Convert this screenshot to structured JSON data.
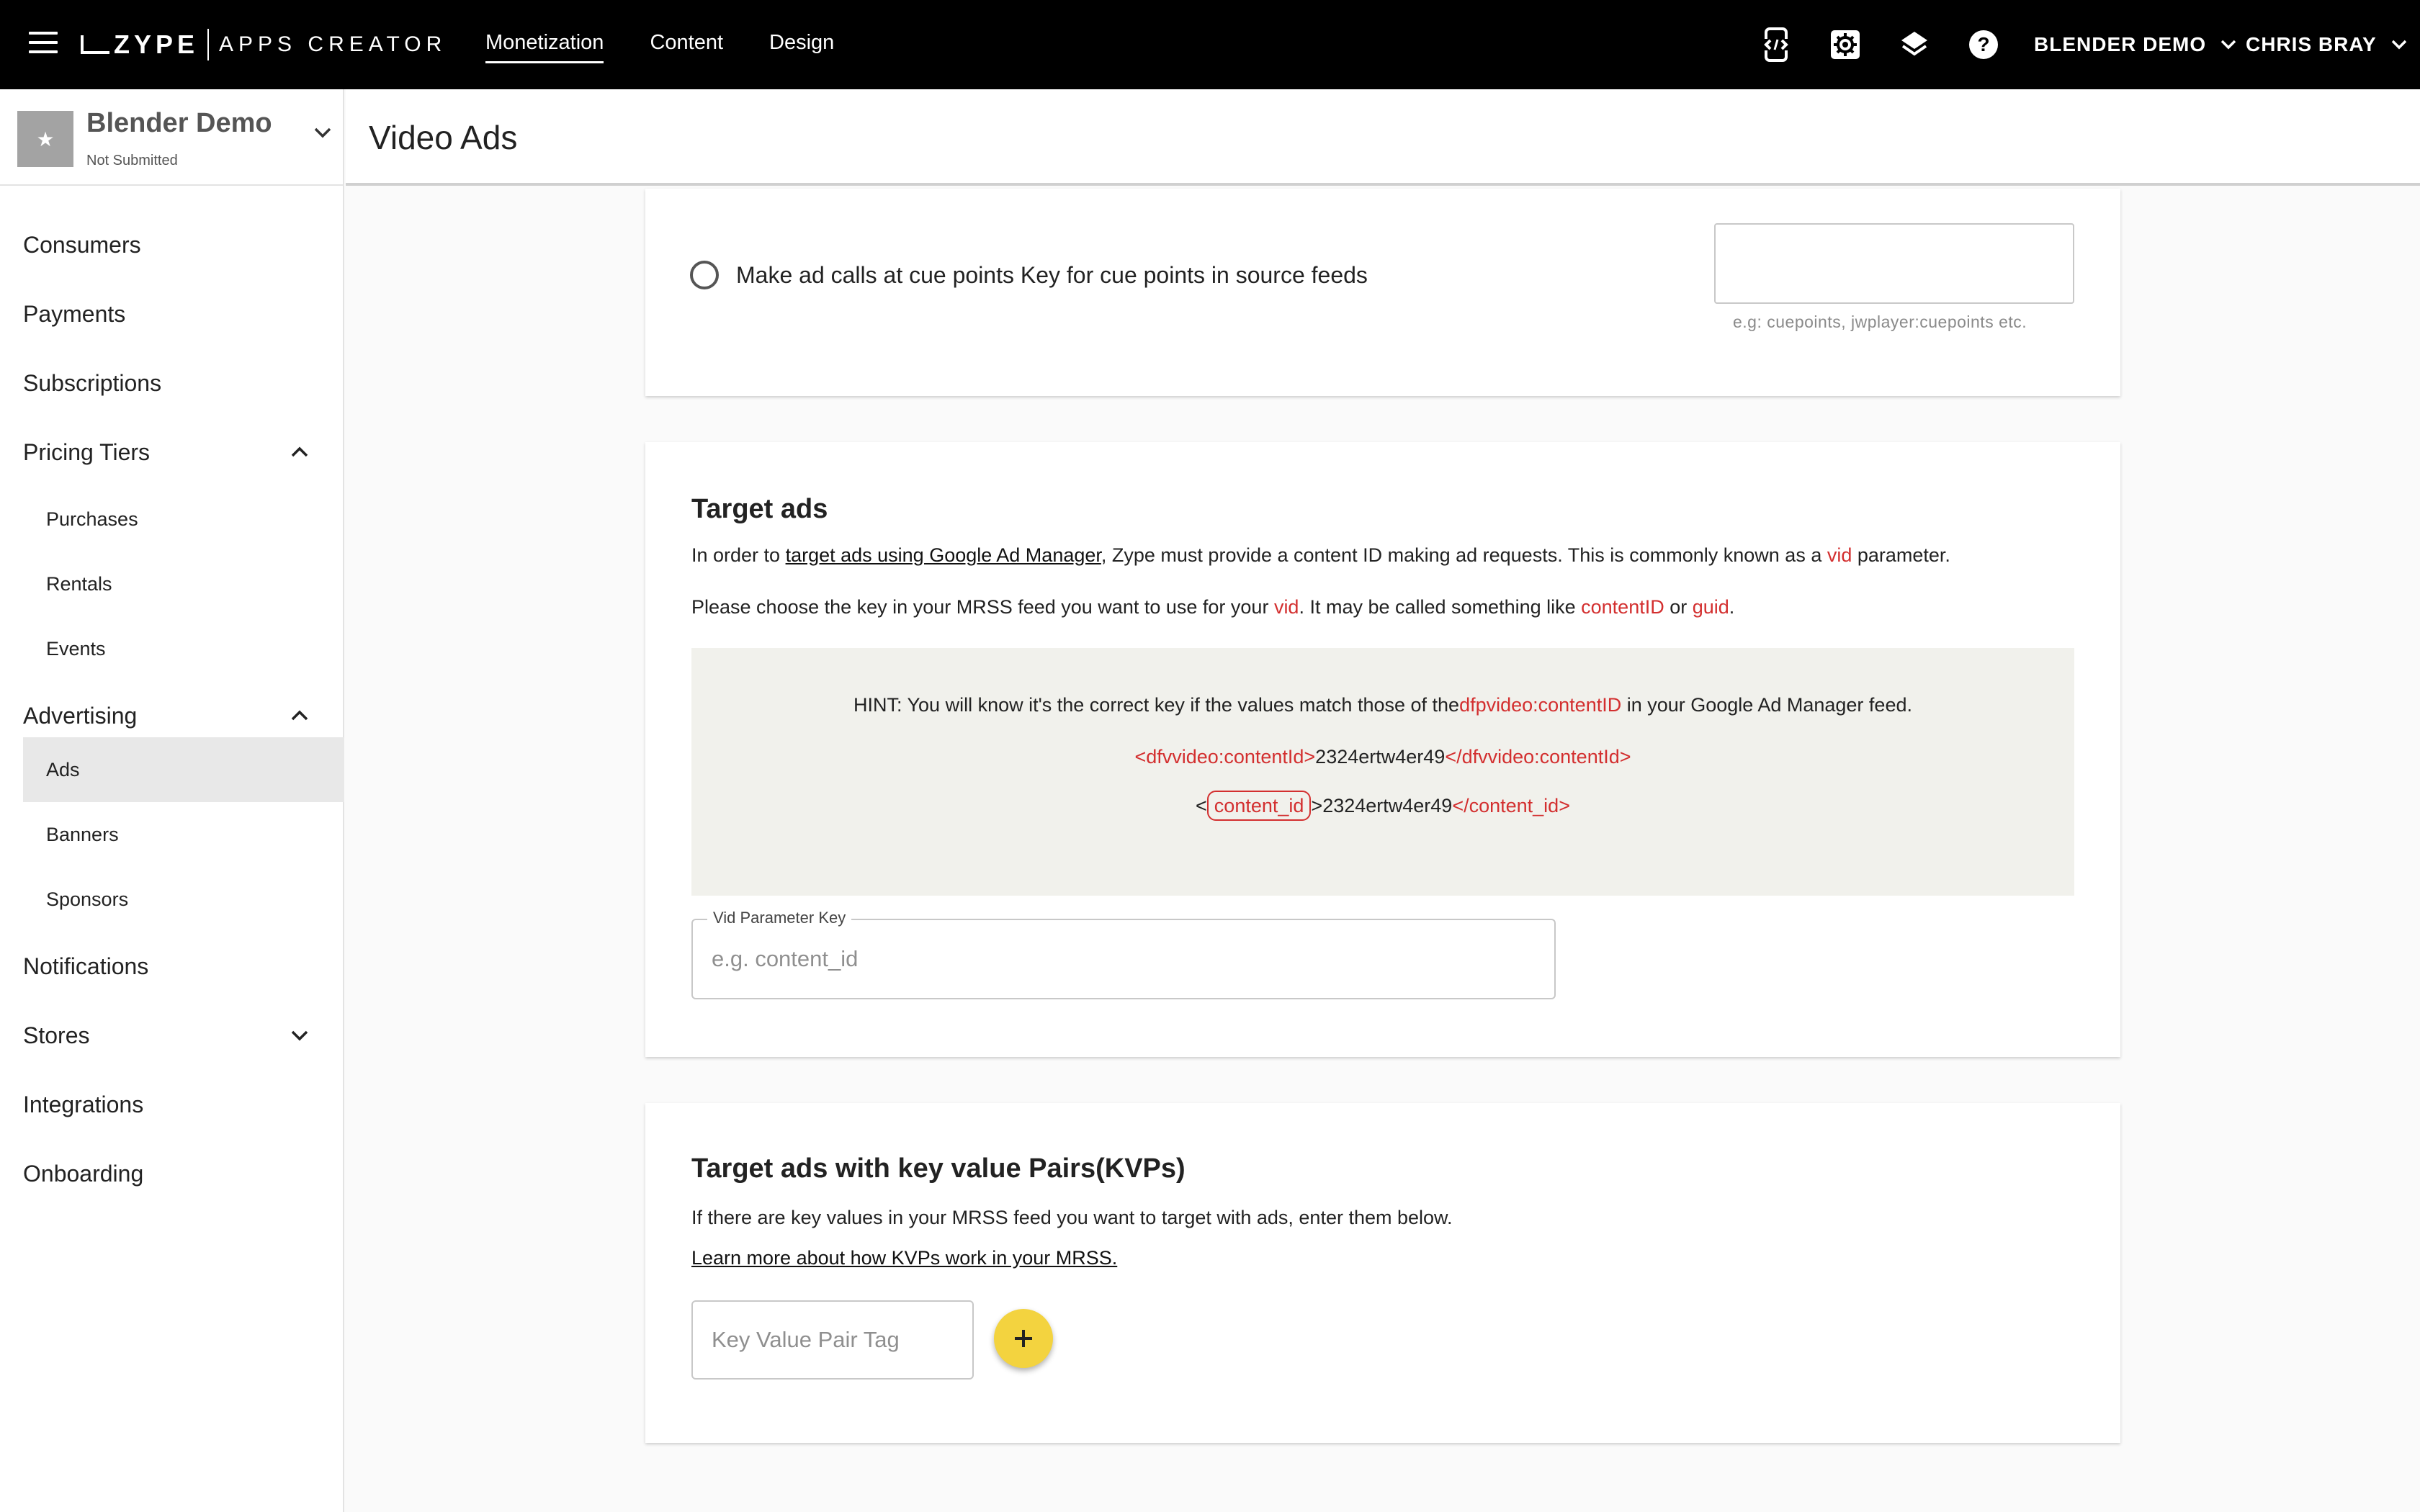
{
  "topbar": {
    "brand_name": "ZYPE",
    "brand_product": "APPS CREATOR",
    "nav": [
      "Monetization",
      "Content",
      "Design"
    ],
    "active_nav": "Monetization",
    "icons": [
      "code-preview-icon",
      "settings-icon",
      "layers-icon",
      "help-icon"
    ],
    "app_selector": "BLENDER DEMO",
    "user_menu": "CHRIS BRAY"
  },
  "sidebar": {
    "app_name": "Blender Demo",
    "app_status": "Not Submitted",
    "items": {
      "consumers": "Consumers",
      "payments": "Payments",
      "subscriptions": "Subscriptions",
      "pricing_tiers": "Pricing Tiers",
      "purchases": "Purchases",
      "rentals": "Rentals",
      "events": "Events",
      "advertising": "Advertising",
      "ads": "Ads",
      "banners": "Banners",
      "sponsors": "Sponsors",
      "notifications": "Notifications",
      "stores": "Stores",
      "integrations": "Integrations",
      "onboarding": "Onboarding"
    },
    "active_item": "Ads"
  },
  "page": {
    "title": "Video Ads"
  },
  "cue_points": {
    "label": "Make ad calls at cue points Key for cue points in source feeds",
    "input_value": "",
    "helper": "e.g: cuepoints, jwplayer:cuepoints etc."
  },
  "target_ads": {
    "heading": "Target ads",
    "p1_prefix": "In order to ",
    "p1_link": "target ads using Google Ad Manager",
    "p1_mid": ", Zype must provide a content ID making ad requests. This is commonly known as a ",
    "p1_vid": "vid",
    "p1_suffix": " parameter.",
    "p2_prefix": "Please choose the key in your MRSS feed you want to use for your ",
    "p2_vid": "vid",
    "p2_mid": ". It may be called something like ",
    "p2_contentid": "contentID",
    "p2_or": " or ",
    "p2_guid": "guid",
    "p2_end": ".",
    "hint_prefix": "HINT: You will know it's the correct key if the values match those of the",
    "hint_key": "dfpvideo:contentID",
    "hint_suffix": " in your Google Ad Manager feed.",
    "example1_open": "<dfvvideo:contentId>",
    "example1_value": "2324ertw4er49",
    "example1_close": "</dfvvideo:contentId>",
    "example2_lt": "<",
    "example2_key": "content_id",
    "example2_gt": ">",
    "example2_value": "2324ertw4er49",
    "example2_close": "</content_id>",
    "field_label": "Vid Parameter Key",
    "field_placeholder": "e.g. content_id",
    "field_value": ""
  },
  "kvp": {
    "heading": "Target ads with key value Pairs(KVPs)",
    "description": "If there are key values in your MRSS feed you want to target with ads, enter them below.",
    "link": "Learn more about how KVPs work in your MRSS.",
    "input_placeholder": "Key Value Pair Tag",
    "input_value": "",
    "add_icon": "plus-icon"
  },
  "colors": {
    "topbar_bg": "#000000",
    "accent_red": "#d32f2f",
    "fab_yellow": "#f3d33f",
    "hint_bg": "#f1f1ec",
    "active_nav_bg": "#e8e8e8"
  }
}
